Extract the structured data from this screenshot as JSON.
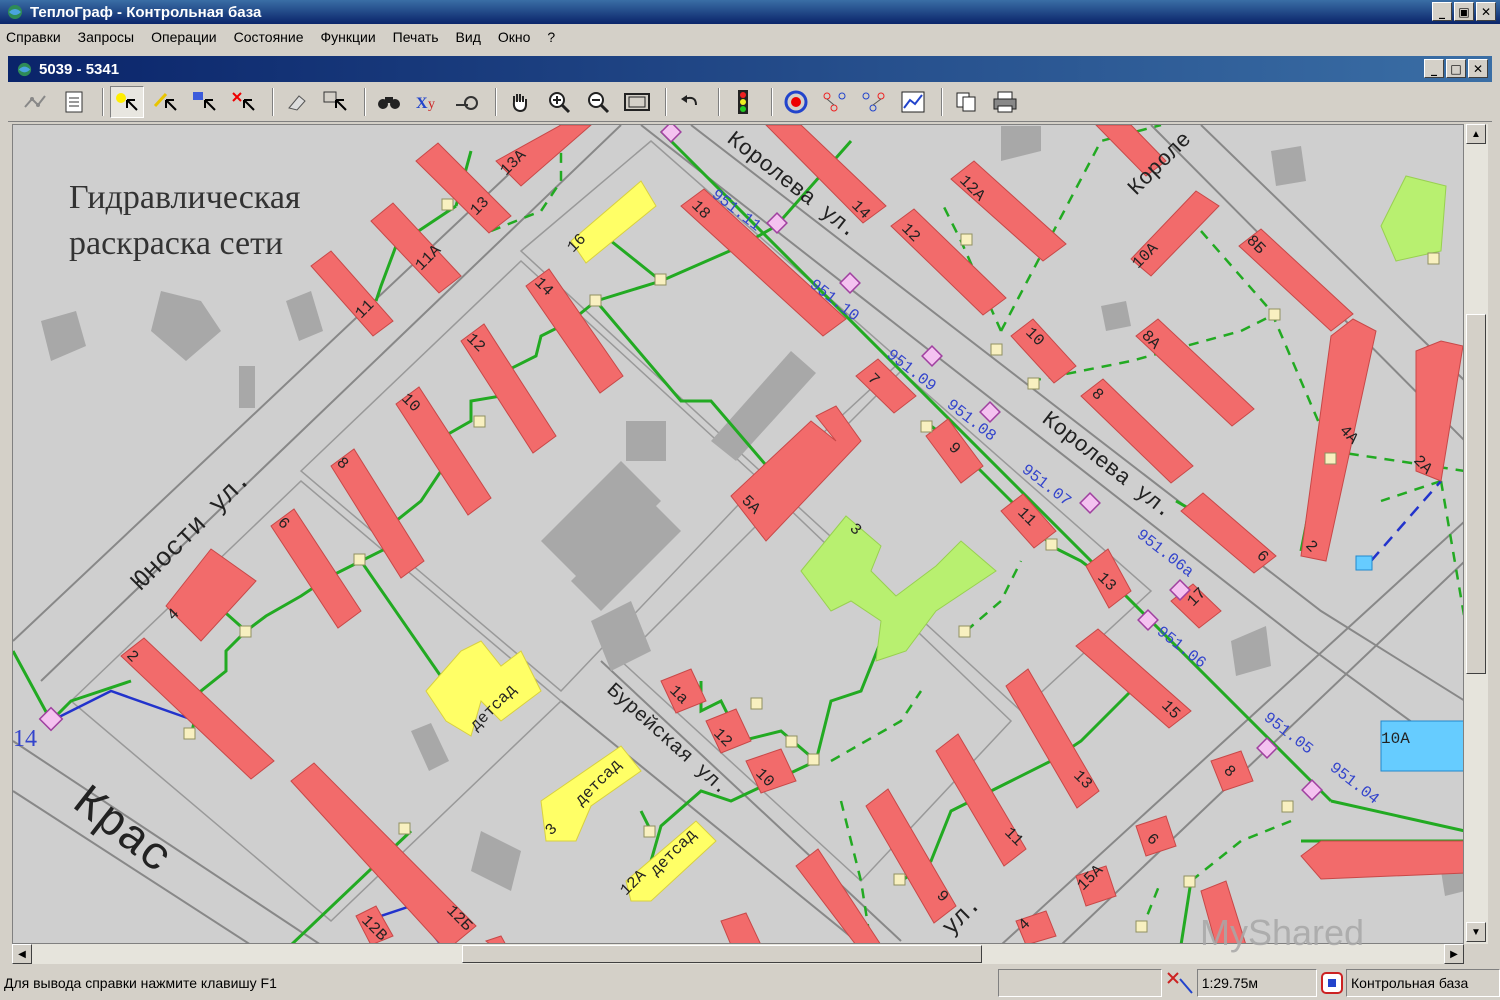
{
  "window": {
    "title": "ТеплоГраф - Контрольная база"
  },
  "menu": [
    "Справки",
    "Запросы",
    "Операции",
    "Состояние",
    "Функции",
    "Печать",
    "Вид",
    "Окно",
    "?"
  ],
  "child_window": {
    "title": "5039 - 5341"
  },
  "map": {
    "caption_line1": "Гидравлическая",
    "caption_line2": "раскраска сети",
    "streets": {
      "yunosti": "Юности ул.",
      "koroleva_top": "Королева ул.",
      "koroleva_mid": "Королева ул.",
      "koroleva_corner": "Короле",
      "bureiskaya": "Бурейская ул.",
      "krasnaya": "Крас",
      "ul_bottom": "ул."
    },
    "buildings": {
      "b11": "11",
      "b11a": "11А",
      "b13": "13",
      "b13a": "13А",
      "b16": "16",
      "b14a": "14",
      "b12": "12",
      "b10": "10",
      "b8": "8",
      "b6": "6",
      "b4": "4",
      "b2": "2",
      "b18": "18",
      "b14": "14",
      "b12b": "12",
      "b12a": "12А",
      "b10a": "10А",
      "b8b": "8Б",
      "b8a": "8А",
      "b10r": "10",
      "b8r": "8",
      "b6r": "6",
      "b7": "7",
      "b9": "9",
      "b11r": "11",
      "b13r": "13",
      "b17": "17",
      "b5a": "5А",
      "b3": "3",
      "b1a": "1а",
      "b12c": "12",
      "b10c": "10",
      "b15": "15",
      "b13c": "13",
      "b11c": "11",
      "b9c": "9",
      "b8c": "8",
      "b6c": "6",
      "b4c": "4",
      "b2c": "2",
      "b12b2": "12Б",
      "b12v": "12В",
      "b15a": "15А",
      "b12a2": "12А",
      "b2a": "2А",
      "b4a": "4А",
      "b10a2": "10А",
      "detsad1": "детсад",
      "detsad2": "детсад",
      "detsad3": "детсад",
      "label14": "14"
    },
    "pipe_labels": [
      "951.11",
      "951.10",
      "951.09",
      "951.08",
      "951.07",
      "951.06а",
      "951.06",
      "951.05",
      "951.04"
    ]
  },
  "statusbar": {
    "help": "Для вывода справки нажмите клавишу F1",
    "scale": "1:29.75м",
    "base": "Контрольная база"
  },
  "watermark": "MyShared",
  "colors": {
    "building_red": "#f26b6b",
    "building_yellow": "#ffff66",
    "building_green": "#b8f070",
    "pipe_green": "#22aa22",
    "pipe_blue": "#2233cc",
    "label_blue": "#3344cc",
    "map_bg": "#cfcfcf",
    "gray_building": "#a8a8a8"
  }
}
